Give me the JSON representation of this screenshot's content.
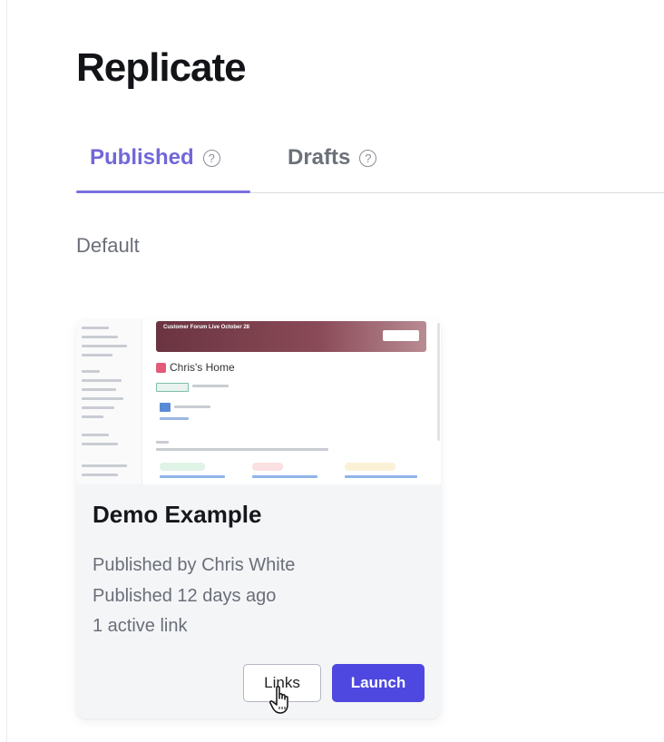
{
  "page": {
    "title": "Replicate"
  },
  "tabs": [
    {
      "label": "Published",
      "help_icon": "question-circle-icon",
      "active": true
    },
    {
      "label": "Drafts",
      "help_icon": "question-circle-icon",
      "active": false
    }
  ],
  "group": {
    "label": "Default"
  },
  "card": {
    "title": "Demo Example",
    "published_by": "Published by Chris White",
    "published_when": "Published 12 days ago",
    "active_links": "1 active link",
    "thumbnail": {
      "banner_title": "Customer Forum Live October 28",
      "page_title": "Chris's Home"
    },
    "buttons": {
      "links": "Links",
      "launch": "Launch"
    }
  },
  "colors": {
    "accent": "#7267d8",
    "primary_button": "#4e48e0",
    "muted_text": "#6a6e78"
  }
}
